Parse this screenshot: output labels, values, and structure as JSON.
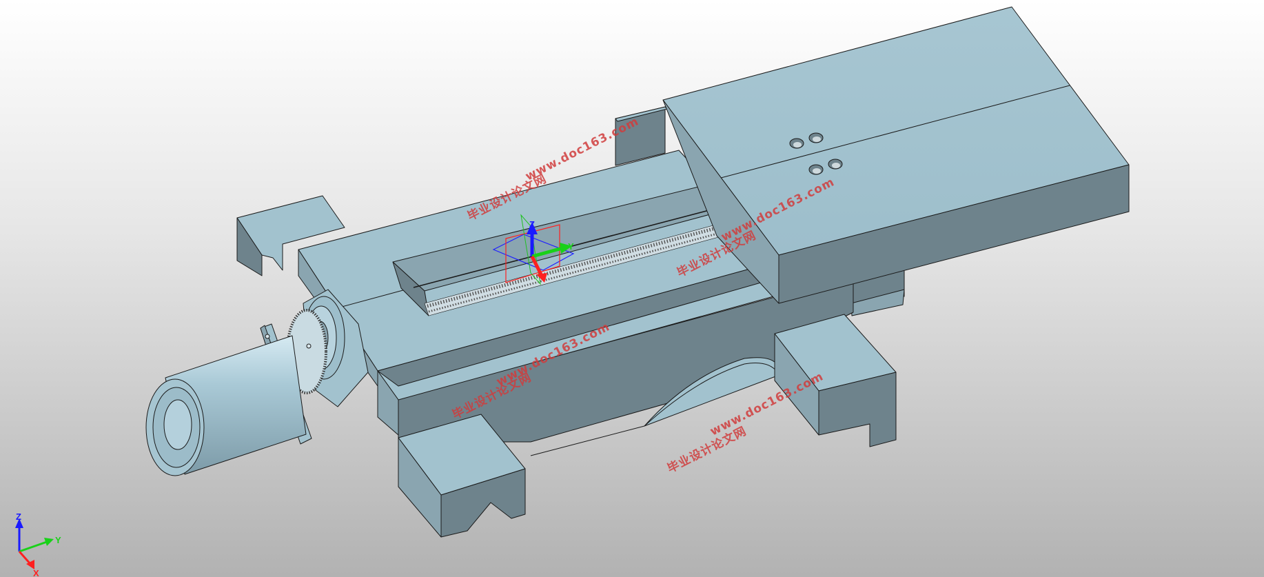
{
  "viewport": {
    "background_top": "#ffffff",
    "background_bottom": "#b2b2b2",
    "part_face_color": "#a2c2ce",
    "part_shadow_color": "#6e838c",
    "edge_color": "#1a1a1a"
  },
  "model_triad": {
    "z_label": "Z",
    "y_label": "Y",
    "z_color": "#1a1aff",
    "y_color": "#19d119",
    "x_color": "#ff2020",
    "plane_colors": [
      "#2020ff",
      "#ff2020",
      "#20c020"
    ]
  },
  "corner_triad": {
    "z_label": "Z",
    "y_label": "Y",
    "x_label": "X",
    "z_color": "#1a1aff",
    "y_color": "#19d119",
    "x_color": "#ff2020"
  },
  "watermarks": {
    "cn": "毕业设计论文网",
    "url": "www.doc163.com",
    "color": "#d03c3c"
  },
  "icons": {
    "model_triad": "coordinate-triad-icon",
    "corner_triad": "view-orientation-icon"
  }
}
